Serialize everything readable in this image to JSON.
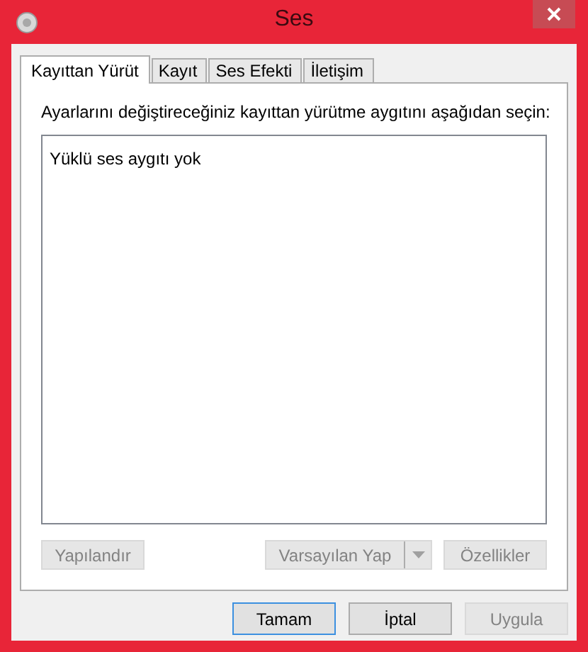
{
  "window": {
    "title": "Ses"
  },
  "tabs": [
    {
      "label": "Kayıttan Yürüt",
      "selected": true
    },
    {
      "label": "Kayıt",
      "selected": false
    },
    {
      "label": "Ses Efekti",
      "selected": false
    },
    {
      "label": "İletişim",
      "selected": false
    }
  ],
  "instruction": "Ayarlarını değiştireceğiniz kayıttan yürütme aygıtını aşağıdan seçin:",
  "device_list": {
    "empty_message": "Yüklü ses aygıtı yok"
  },
  "panel_buttons": [
    {
      "kind": "plain",
      "label": "Yapılandır",
      "disabled": true
    },
    {
      "kind": "split",
      "label": "Varsayılan Yap",
      "disabled": true
    },
    {
      "kind": "plain",
      "label": "Özellikler",
      "disabled": true
    }
  ],
  "dialog_buttons": [
    {
      "label": "Tamam",
      "disabled": false,
      "default": true
    },
    {
      "label": "İptal",
      "disabled": false,
      "default": false
    },
    {
      "label": "Uygula",
      "disabled": true,
      "default": false
    }
  ]
}
